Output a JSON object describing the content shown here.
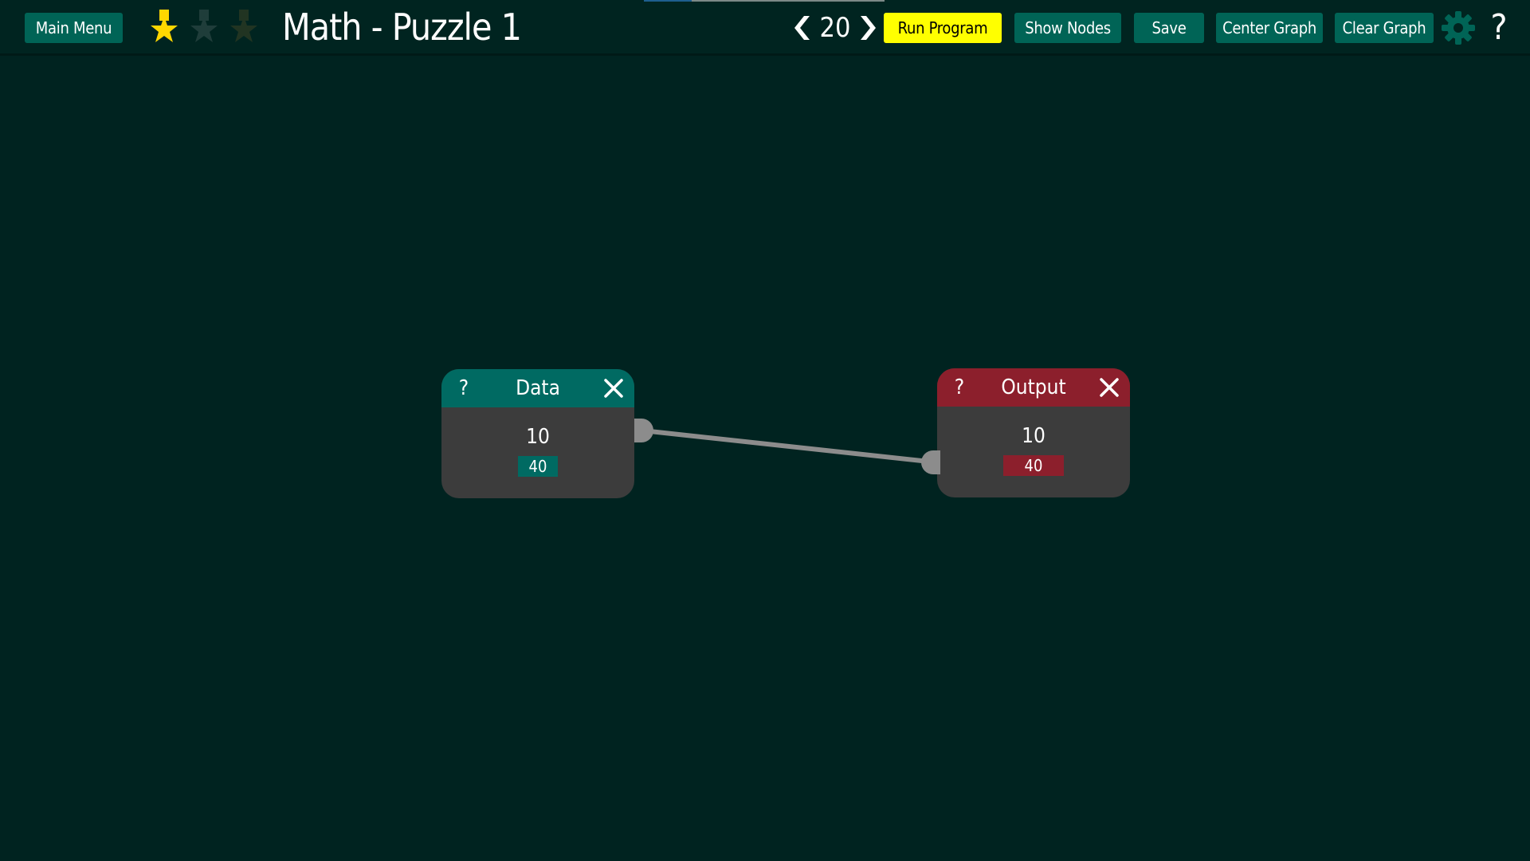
{
  "topbar": {
    "main_menu_label": "Main Menu",
    "stars_earned": 1,
    "stars_total": 3,
    "title": "Math - Puzzle 1",
    "speed_value": "20",
    "run_label": "Run Program",
    "show_nodes_label": "Show Nodes",
    "save_label": "Save",
    "center_graph_label": "Center Graph",
    "clear_graph_label": "Clear Graph",
    "help_label": "?",
    "progress_fraction": 0.2
  },
  "icons": {
    "star_earned": "star-icon",
    "star_unearned": "star-icon",
    "prev": "chevron-left-icon",
    "next": "chevron-right-icon",
    "settings": "gear-icon",
    "close": "close-icon"
  },
  "colors": {
    "background": "#002320",
    "button": "#006456",
    "run_button": "#ffff00",
    "star_gold": "#ffd700",
    "data_header": "#006a62",
    "output_header": "#8c1f2c",
    "node_body": "#3c3c3c",
    "wire": "#8c8c8c"
  },
  "nodes": {
    "data": {
      "help": "?",
      "title": "Data",
      "value": "10",
      "badge": "40"
    },
    "output": {
      "help": "?",
      "title": "Output",
      "value": "10",
      "badge": "40"
    }
  }
}
